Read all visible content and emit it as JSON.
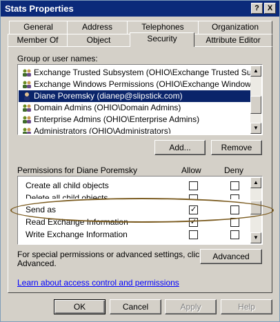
{
  "window": {
    "title": "Stats Properties",
    "help_btn": "?",
    "close_btn": "X"
  },
  "tabs": {
    "row1": [
      "General",
      "Address",
      "Telephones",
      "Organization"
    ],
    "row2": [
      "Member Of",
      "Object",
      "Security",
      "Attribute Editor"
    ],
    "active": "Security"
  },
  "group_section": {
    "label": "Group or user names:",
    "users": [
      "Exchange Trusted Subsystem (OHIO\\Exchange Trusted Subsys...",
      "Exchange Windows Permissions (OHIO\\Exchange Windows Pe...",
      "Diane Poremsky (dianep@slipstick.com)",
      "Domain Admins (OHIO\\Domain Admins)",
      "Enterprise Admins (OHIO\\Enterprise Admins)",
      "Administrators (OHIO\\Administrators)"
    ],
    "selected_index": 2,
    "add_button": "Add...",
    "remove_button": "Remove"
  },
  "permissions": {
    "label": "Permissions for Diane Poremsky",
    "allow_header": "Allow",
    "deny_header": "Deny",
    "rows": [
      {
        "name": "Create all child objects",
        "allow": false,
        "deny": false
      },
      {
        "name": "Delete all child objects",
        "allow": false,
        "deny": false
      },
      {
        "name": "Send as",
        "allow": true,
        "deny": false
      },
      {
        "name": "Read Exchange Information",
        "allow": true,
        "deny": false
      },
      {
        "name": "Write Exchange Information",
        "allow": false,
        "deny": false
      }
    ],
    "check_mark": "✓"
  },
  "advanced": {
    "text_line1": "For special permissions or advanced settings, click",
    "text_line2": "Advanced.",
    "button": "Advanced"
  },
  "learn_link": "Learn about access control and permissions",
  "footer": {
    "ok": "OK",
    "cancel": "Cancel",
    "apply": "Apply",
    "help": "Help"
  }
}
